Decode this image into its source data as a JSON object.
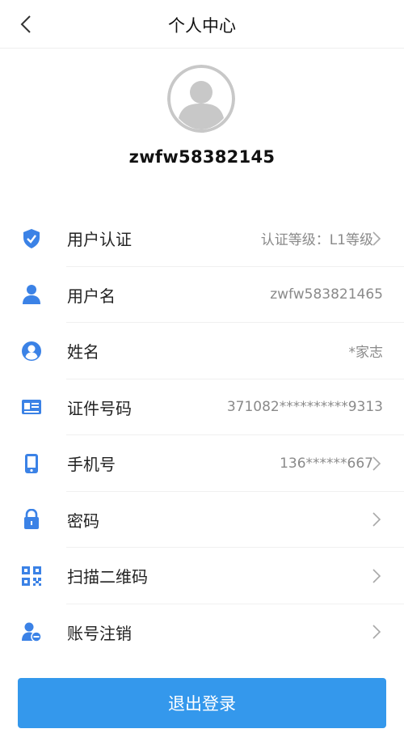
{
  "header": {
    "title": "个人中心"
  },
  "profile": {
    "username": "zwfw58382145"
  },
  "rows": [
    {
      "label": "用户认证",
      "value": "认证等级：L1等级",
      "arrow": true
    },
    {
      "label": "用户名",
      "value": "zwfw583821465",
      "arrow": false
    },
    {
      "label": "姓名",
      "value": "*家志",
      "arrow": false
    },
    {
      "label": "证件号码",
      "value": "371082**********9313",
      "arrow": false
    },
    {
      "label": "手机号",
      "value": "136******667",
      "arrow": true
    },
    {
      "label": "密码",
      "value": "",
      "arrow": true
    },
    {
      "label": "扫描二维码",
      "value": "",
      "arrow": true
    },
    {
      "label": "账号注销",
      "value": "",
      "arrow": true
    }
  ],
  "logout": {
    "label": "退出登录"
  },
  "colors": {
    "accent": "#3498ec",
    "icon": "#3b82e6"
  },
  "icons": [
    "back-arrow-icon",
    "avatar-icon",
    "shield-check-icon",
    "user-icon",
    "person-circle-icon",
    "id-card-icon",
    "phone-icon",
    "lock-icon",
    "qr-code-icon",
    "user-cancel-icon",
    "chevron-right-icon"
  ]
}
